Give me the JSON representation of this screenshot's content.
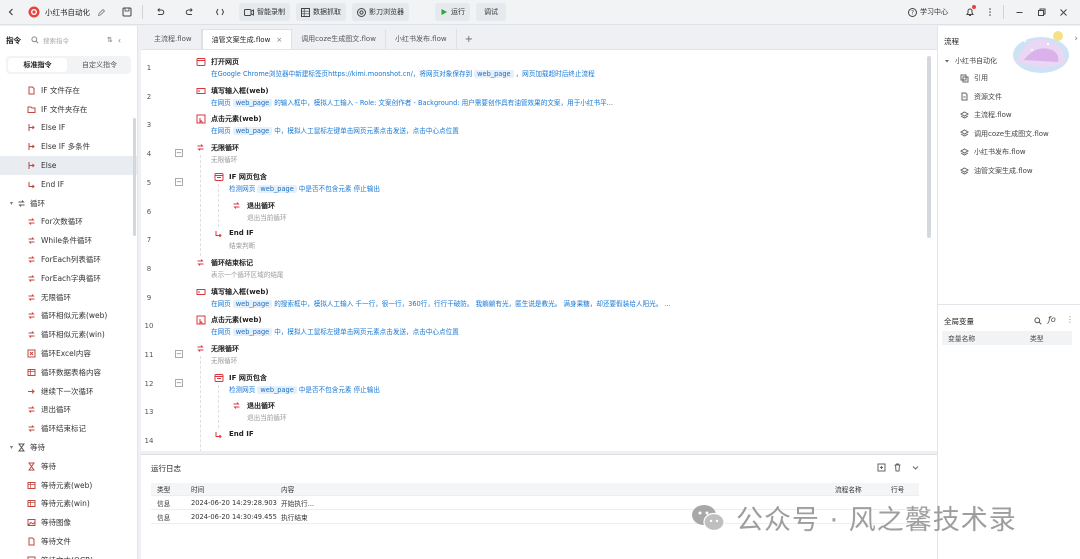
{
  "titlebar": {
    "app_title": "小红书自动化",
    "smart_record": "智能录制",
    "data_grab": "数据抓取",
    "browser": "影刀浏览器",
    "run": "运行",
    "debug": "调试",
    "learning_center": "学习中心"
  },
  "left": {
    "header": "指令",
    "search_placeholder": "搜索指令",
    "tab_standard": "标准指令",
    "tab_custom": "自定义指令",
    "items": [
      {
        "label": "IF 文件存在",
        "icon": "file-if-icon"
      },
      {
        "label": "IF 文件夹存在",
        "icon": "folder-if-icon"
      },
      {
        "label": "Else IF",
        "icon": "else-if-icon"
      },
      {
        "label": "Else IF 多条件",
        "icon": "else-if-icon"
      },
      {
        "label": "Else",
        "icon": "else-icon"
      },
      {
        "label": "End IF",
        "icon": "end-if-icon"
      },
      {
        "label": "循环",
        "icon": "loop-icon",
        "category": true
      },
      {
        "label": "For次数循环",
        "icon": "loop-icon"
      },
      {
        "label": "While条件循环",
        "icon": "loop-icon"
      },
      {
        "label": "ForEach列表循环",
        "icon": "loop-icon"
      },
      {
        "label": "ForEach字典循环",
        "icon": "loop-icon"
      },
      {
        "label": "无限循环",
        "icon": "loop-icon"
      },
      {
        "label": "循环相似元素(web)",
        "icon": "loop-icon"
      },
      {
        "label": "循环相似元素(win)",
        "icon": "loop-icon"
      },
      {
        "label": "循环Excel内容",
        "icon": "excel-icon"
      },
      {
        "label": "循环数据表格内容",
        "icon": "table-icon"
      },
      {
        "label": "继续下一次循环",
        "icon": "next-loop-icon"
      },
      {
        "label": "退出循环",
        "icon": "loop-icon"
      },
      {
        "label": "循环结束标记",
        "icon": "loop-icon"
      },
      {
        "label": "等待",
        "icon": "hourglass-icon",
        "category": true
      },
      {
        "label": "等待",
        "icon": "hourglass-icon"
      },
      {
        "label": "等待元素(web)",
        "icon": "wait-element-icon"
      },
      {
        "label": "等待元素(win)",
        "icon": "wait-element-icon"
      },
      {
        "label": "等待图像",
        "icon": "image-icon"
      },
      {
        "label": "等待文件",
        "icon": "file-icon"
      },
      {
        "label": "等待文本(OCR)",
        "icon": "ocr-icon"
      }
    ]
  },
  "editor": {
    "tabs": [
      {
        "label": "主流程.flow",
        "active": false
      },
      {
        "label": "油管文案生成.flow",
        "active": true
      },
      {
        "label": "调用coze生成图文.flow",
        "active": false
      },
      {
        "label": "小红书发布.flow",
        "active": false
      }
    ],
    "steps": [
      {
        "num": "1",
        "title": "打开网页",
        "icon": "browser-icon",
        "depth": 0,
        "fold": false,
        "desc": [
          {
            "t": "在Google Chrome浏览器中新建标签页https://kimi.moonshot.cn/，将网页对象保存到"
          },
          {
            "t": "web_page",
            "tag": true
          },
          {
            "t": "，网页加载超时后终止流程"
          }
        ]
      },
      {
        "num": "2",
        "title": "填写输入框(web)",
        "icon": "input-icon",
        "depth": 0,
        "fold": false,
        "desc": [
          {
            "t": "在网页"
          },
          {
            "t": "web_page",
            "tag": true
          },
          {
            "t": "的输入框中，模拟人工输入 - Role: 文案创作者 - Background: 用户需要创作具有油管效果的文案，用于小红书平..."
          }
        ]
      },
      {
        "num": "3",
        "title": "点击元素(web)",
        "icon": "click-icon",
        "depth": 0,
        "fold": false,
        "desc": [
          {
            "t": "在网页"
          },
          {
            "t": "web_page",
            "tag": true
          },
          {
            "t": "中，模拟人工鼠标左键单击网页元素点击发送，点击中心点位置"
          }
        ]
      },
      {
        "num": "4",
        "title": "无限循环",
        "icon": "loop-icon",
        "depth": 0,
        "fold": true,
        "desc": [
          {
            "t": "无限循环"
          }
        ],
        "gray": true
      },
      {
        "num": "5",
        "title": "IF 网页包含",
        "icon": "if-web-icon",
        "depth": 1,
        "fold": true,
        "desc": [
          {
            "t": "检测网页"
          },
          {
            "t": "web_page",
            "tag": true
          },
          {
            "t": "中是否不包含元素 停止输出"
          }
        ]
      },
      {
        "num": "6",
        "title": "退出循环",
        "icon": "loop-icon",
        "depth": 2,
        "fold": false,
        "desc": [
          {
            "t": "退出当前循环"
          }
        ],
        "gray": true
      },
      {
        "num": "7",
        "title": "End IF",
        "icon": "end-if-icon",
        "depth": 1,
        "fold": false,
        "desc": [
          {
            "t": "结束判断"
          }
        ],
        "gray": true
      },
      {
        "num": "8",
        "title": "循环结束标记",
        "icon": "loop-icon",
        "depth": 0,
        "fold": false,
        "desc": [
          {
            "t": "表示一个循环区域的结尾"
          }
        ],
        "gray": true
      },
      {
        "num": "9",
        "title": "填写输入框(web)",
        "icon": "input-icon",
        "depth": 0,
        "fold": false,
        "desc": [
          {
            "t": "在网页"
          },
          {
            "t": "web_page",
            "tag": true
          },
          {
            "t": "的搜索框中，模拟人工输入 千一行，很一行，360行，行行干破防。 我躺躺有光，匿生说是教光。 满身果糖，却还要假装给人阳光。 ..."
          }
        ]
      },
      {
        "num": "10",
        "title": "点击元素(web)",
        "icon": "click-icon",
        "depth": 0,
        "fold": false,
        "desc": [
          {
            "t": "在网页"
          },
          {
            "t": "web_page",
            "tag": true
          },
          {
            "t": "中，模拟人工鼠标左键单击网页元素点击发送，点击中心点位置"
          }
        ]
      },
      {
        "num": "11",
        "title": "无限循环",
        "icon": "loop-icon",
        "depth": 0,
        "fold": true,
        "desc": [
          {
            "t": "无限循环"
          }
        ],
        "gray": true
      },
      {
        "num": "12",
        "title": "IF 网页包含",
        "icon": "if-web-icon",
        "depth": 1,
        "fold": true,
        "desc": [
          {
            "t": "检测网页"
          },
          {
            "t": "web_page",
            "tag": true
          },
          {
            "t": "中是否不包含元素 停止输出"
          }
        ]
      },
      {
        "num": "13",
        "title": "退出循环",
        "icon": "loop-icon",
        "depth": 2,
        "fold": false,
        "desc": [
          {
            "t": "退出当前循环"
          }
        ],
        "gray": true
      },
      {
        "num": "14",
        "title": "End IF",
        "icon": "end-if-icon",
        "depth": 1,
        "fold": false,
        "desc": [
          {
            "t": ""
          }
        ],
        "gray": true
      }
    ]
  },
  "log": {
    "title": "运行日志",
    "headers": [
      "类型",
      "时间",
      "内容",
      "流程名称",
      "行号"
    ],
    "rows": [
      {
        "type": "信息",
        "time": "2024-06-20 14:29:28.903",
        "content": "开始执行...",
        "flow": "",
        "line": ""
      },
      {
        "type": "信息",
        "time": "2024-06-20 14:30:49.455",
        "content": "执行结束",
        "flow": "",
        "line": ""
      }
    ]
  },
  "right": {
    "header": "流程",
    "tree": [
      {
        "label": "小红书自动化",
        "icon": "caret-down-icon",
        "level": 0
      },
      {
        "label": "引用",
        "icon": "reference-icon",
        "level": 1
      },
      {
        "label": "资源文件",
        "icon": "resource-file-icon",
        "level": 1
      },
      {
        "label": "主流程.flow",
        "icon": "flow-icon",
        "level": 1
      },
      {
        "label": "调用coze生成图文.flow",
        "icon": "flow-icon",
        "level": 1
      },
      {
        "label": "小红书发布.flow",
        "icon": "flow-icon",
        "level": 1
      },
      {
        "label": "油管文案生成.flow",
        "icon": "flow-icon",
        "level": 1
      }
    ],
    "vars_header": "全局变量",
    "vars_col_name": "变量名称",
    "vars_col_type": "类型"
  },
  "watermark": {
    "text": "公众号 · 风之馨技术录"
  },
  "colors": {
    "accent": "#1677d4",
    "tag_bg": "#e6f0fb",
    "step_icon": "#d9363e",
    "run_green": "#2aa540"
  }
}
